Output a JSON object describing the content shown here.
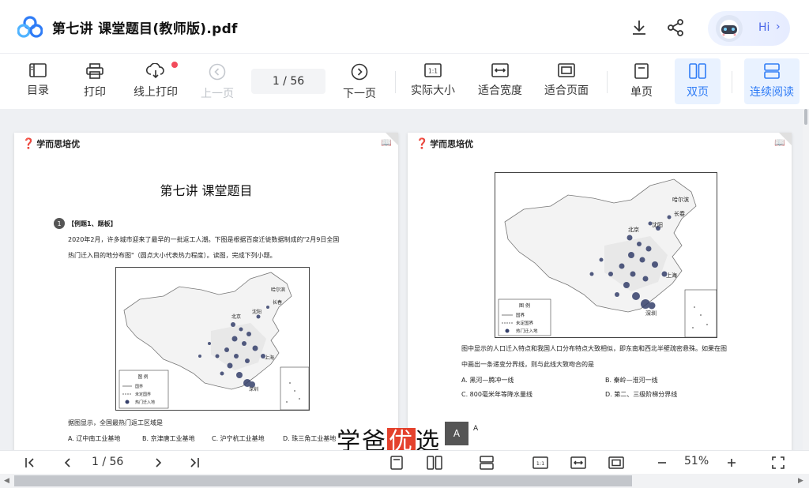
{
  "header": {
    "title": "第七讲 课堂题目(教师版).pdf",
    "hi_label": "Hi"
  },
  "toolbar": {
    "toc": "目录",
    "print": "打印",
    "online_print": "线上打印",
    "prev_page": "上一页",
    "page_indicator": "1 / 56",
    "next_page": "下一页",
    "actual_size": "实际大小",
    "fit_width": "适合宽度",
    "fit_page": "适合页面",
    "single_page": "单页",
    "double_page": "双页",
    "continuous": "连续阅读"
  },
  "left_page": {
    "brand": "学而思培优",
    "title": "第七讲 课堂题目",
    "q_number": "1",
    "q_tag": "【例题1、题板】",
    "q_line1": "2020年2月，许多城市迎来了最早的一批返工人潮。下图是根据百度迁徙数据制成的\"2月9日全国",
    "q_line2": "热门迁入目的地分布图\"（圆点大小代表热力程度）。读图，完成下列小题。",
    "map_labels": {
      "harbin": "哈尔滨",
      "changchun": "长春",
      "shenyang": "沈阳",
      "beijing": "北京",
      "shanghai": "上海",
      "shenzhen": "深圳"
    },
    "legend": {
      "title": "图 例",
      "border": "国界",
      "undefined": "未定国界",
      "hot": "热门迁入地"
    },
    "question": "据图显示，全国最热门返工区域是",
    "options": [
      "A. 辽中南工业基地",
      "B. 京津唐工业基地",
      "C. 沪宁杭工业基地",
      "D. 珠三角工业基地"
    ]
  },
  "right_page": {
    "brand": "学而思培优",
    "map_labels": {
      "harbin": "哈尔滨",
      "changchun": "长春",
      "shenyang": "沈阳",
      "beijing": "北京",
      "shanghai": "上海",
      "shenzhen": "深圳"
    },
    "legend": {
      "title": "图 例",
      "border": "国界",
      "undefined": "未定国界",
      "hot": "热门迁入地"
    },
    "line1": "图中显示的人口迁入特点和我国人口分布特点大致相似，即东南和西北半壁疏密悬殊。如果在图",
    "line2": "中画出一条递变分界线，则与此线大致吻合的是",
    "options": [
      "A. 黑河—腾冲一线",
      "B. 秦岭—淮河一线",
      "C. 800毫米年等降水量线",
      "D. 第二、三级阶梯分界线"
    ]
  },
  "watermark": {
    "text1": "学爸",
    "text2": "优",
    "text3": "选",
    "badge": "A",
    "a": "A"
  },
  "bottom": {
    "page_indicator": "1 / 56",
    "zoom": "51%"
  }
}
